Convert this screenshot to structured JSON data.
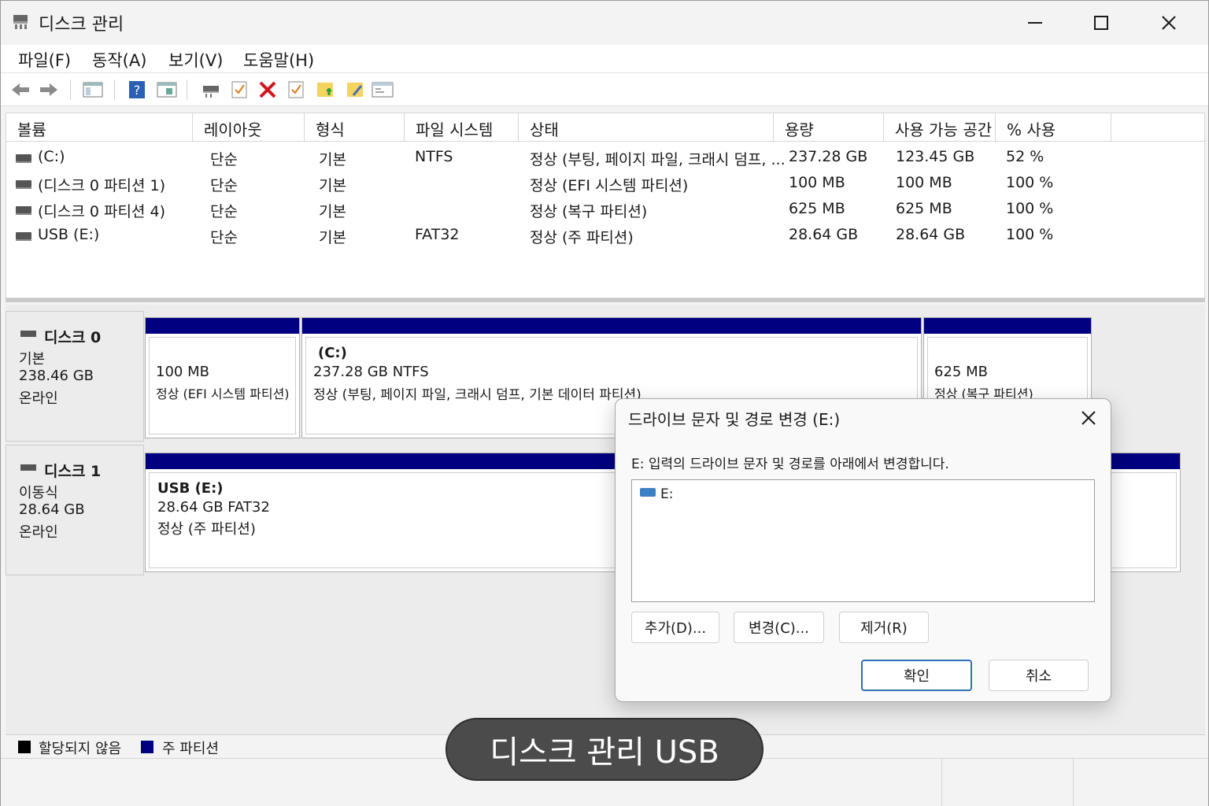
{
  "window": {
    "title": "디스크 관리",
    "icons": [
      "disk-management-icon",
      "minimize-icon",
      "maximize-icon",
      "close-icon"
    ]
  },
  "menu": [
    "파일(F)",
    "동작(A)",
    "보기(V)",
    "도움말(H)"
  ],
  "toolbar": {
    "icons": [
      "back-arrow-icon",
      "forward-arrow-icon",
      "console-tree-icon",
      "help-icon",
      "properties-icon",
      "connect-drive-icon",
      "check-icon",
      "delete-x-icon",
      "check-icon",
      "new-folder-icon",
      "edit-icon",
      "settings-window-icon"
    ]
  },
  "volumes": {
    "headers": [
      "볼륨",
      "레이아웃",
      "형식",
      "파일 시스템",
      "상태",
      "용량",
      "사용 가능 공간",
      "% 사용"
    ],
    "rows": [
      {
        "volume": "(C:)",
        "layout": "단순",
        "type": "기본",
        "fs": "NTFS",
        "status": "정상 (부팅, 페이지 파일, 크래시 덤프, ...",
        "capacity": "237.28 GB",
        "free": "123.45 GB",
        "percent": "52 %"
      },
      {
        "volume": "(디스크 0 파티션 1)",
        "layout": "단순",
        "type": "기본",
        "fs": "",
        "status": "정상 (EFI 시스템 파티션)",
        "capacity": "100 MB",
        "free": "100 MB",
        "percent": "100 %"
      },
      {
        "volume": "(디스크 0 파티션 4)",
        "layout": "단순",
        "type": "기본",
        "fs": "",
        "status": "정상 (복구 파티션)",
        "capacity": "625 MB",
        "free": "625 MB",
        "percent": "100 %"
      },
      {
        "volume": "USB  (E:)",
        "layout": "단순",
        "type": "기본",
        "fs": "FAT32",
        "status": "정상 (주 파티션)",
        "capacity": "28.64 GB",
        "free": "28.64 GB",
        "percent": "100 %"
      }
    ]
  },
  "disks": {
    "disk0": {
      "name": "디스크 0",
      "kind": "기본",
      "size": "238.46 GB",
      "state": "온라인",
      "p1": {
        "size": "100 MB",
        "status": "정상 (EFI 시스템 파티션)"
      },
      "p2": {
        "label": "(C:)",
        "size": "237.28 GB NTFS",
        "status": "정상 (부팅, 페이지 파일, 크래시 덤프, 기본 데이터 파티션)"
      },
      "p3": {
        "size": "625 MB",
        "status": "정상 (복구 파티션)"
      }
    },
    "disk1": {
      "name": "디스크 1",
      "kind": "이동식",
      "size": "28.64 GB",
      "state": "온라인",
      "p1": {
        "label": "USB   (E:)",
        "size": "28.64 GB FAT32",
        "status": "정상 (주 파티션)"
      }
    }
  },
  "legend": {
    "unallocated": "할당되지 않음",
    "primary": "주 파티션",
    "unallocated_color": "#000000",
    "primary_color": "#000080"
  },
  "dialog": {
    "title": "드라이브 문자 및 경로 변경 (E:)",
    "description": "E: 입력의 드라이브 문자 및 경로를 아래에서 변경합니다.",
    "list_item": "E:",
    "add": "추가(D)...",
    "change": "변경(C)...",
    "remove": "제거(R)",
    "ok": "확인",
    "cancel": "취소"
  },
  "caption": "디스크 관리 USB"
}
